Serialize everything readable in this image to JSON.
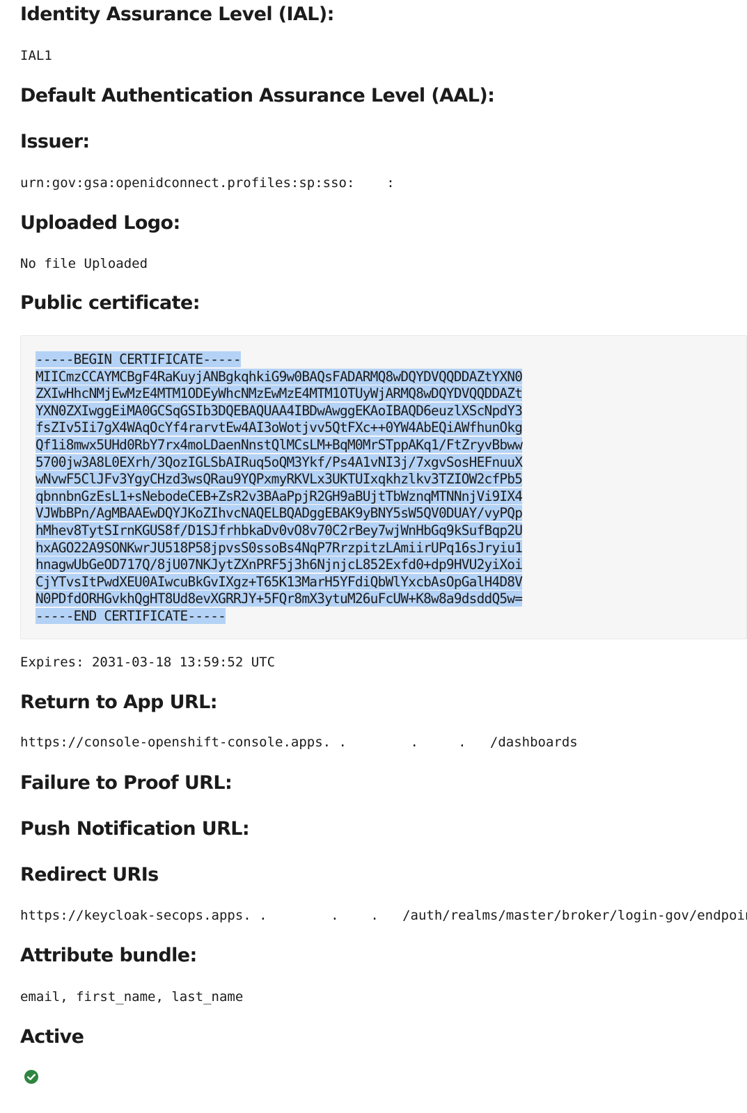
{
  "fields": {
    "ial": {
      "label": "Identity Assurance Level (IAL):",
      "value": "IAL1"
    },
    "aal": {
      "label": "Default Authentication Assurance Level (AAL):"
    },
    "issuer": {
      "label": "Issuer:",
      "value": "urn:gov:gsa:openidconnect.profiles:sp:sso:    :"
    },
    "logo": {
      "label": "Uploaded Logo:",
      "value": "No file Uploaded"
    },
    "certificate": {
      "label": "Public certificate:",
      "lines": [
        "-----BEGIN CERTIFICATE-----",
        "MIICmzCCAYMCBgF4RaKuyjANBgkqhkiG9w0BAQsFADARMQ8wDQYDVQQDDAZtYXN0",
        "ZXIwHhcNMjEwMzE4MTM1ODEyWhcNMzEwMzE4MTM1OTUyWjARMQ8wDQYDVQQDDAZt",
        "YXN0ZXIwggEiMA0GCSqGSIb3DQEBAQUAA4IBDwAwggEKAoIBAQD6euzlXScNpdY3",
        "fsZIv5Ii7gX4WAqOcYf4rarvtEw4AI3oWotjvv5QtFXc++0YW4AbEQiAWfhunOkg",
        "Qf1i8mwx5UHd0RbY7rx4moLDaenNnstQlMCsLM+BqM0MrSTppAKq1/FtZryvBbww",
        "5700jw3A8L0EXrh/3QozIGLSbAIRuq5oQM3Ykf/Ps4A1vNI3j/7xgvSosHEFnuuX",
        "wNvwF5ClJFv3YgyCHzd3wsQRau9YQPxmyRKVLx3UKTUIxqkhzlkv3TZIOW2cfPb5",
        "qbnnbnGzEsL1+sNebodeCEB+ZsR2v3BAaPpjR2GH9aBUjtTbWznqMTNNnjVi9IX4",
        "VJWbBPn/AgMBAAEwDQYJKoZIhvcNAQELBQADggEBAK9yBNY5sW5QV0DUAY/vyPQp",
        "hMhev8TytSIrnKGUS8f/D1SJfrhbkaDv0vO8v70C2rBey7wjWnHbGq9kSufBqp2U",
        "hxAGO22A9SONKwrJU518P58jpvsS0ssoBs4NqP7RrzpitzLAmiirUPq16sJryiu1",
        "hnagwUbGeOD717Q/8jU07NKJytZXnPRF5j3h6NjnjcL852Exfd0+dp9HVU2yiXoi",
        "CjYTvsItPwdXEU0AIwcuBkGvIXgz+T65K13MarH5YFdiQbWlYxcbAsOpGalH4D8V",
        "N0PDfdORHGvkhQgHT8Ud8evXGRRJY+5FQr8mX3ytuM26uFcUW+K8w8a9dsddQ5w=",
        "-----END CERTIFICATE-----"
      ],
      "expires": "Expires: 2031-03-18 13:59:52 UTC"
    },
    "return_url": {
      "label": "Return to App URL:",
      "value": "https://console-openshift-console.apps. .        .     .   /dashboards"
    },
    "failure_url": {
      "label": "Failure to Proof URL:"
    },
    "push_url": {
      "label": "Push Notification URL:"
    },
    "redirect_uris": {
      "label": "Redirect URIs",
      "value": "https://keycloak-secops.apps. .        .    .   /auth/realms/master/broker/login-gov/endpoint"
    },
    "attribute_bundle": {
      "label": "Attribute bundle:",
      "value": "email, first_name, last_name"
    },
    "active": {
      "label": "Active",
      "icon": "check-circle-icon",
      "icon_color": "#2e8540"
    }
  }
}
